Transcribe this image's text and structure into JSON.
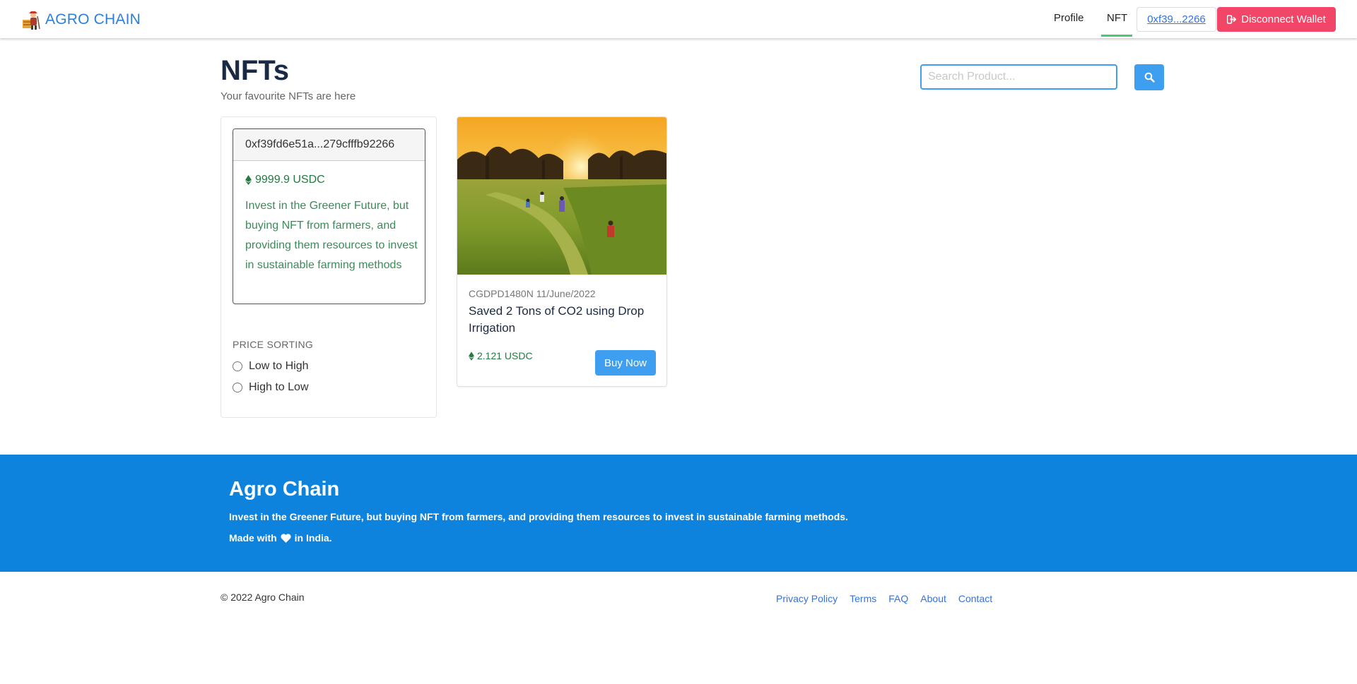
{
  "navbar": {
    "brand": "AGRO CHAIN",
    "links": [
      {
        "label": "Profile"
      },
      {
        "label": "NFT"
      }
    ],
    "wallet_short": "0xf39...2266",
    "disconnect_label": "Disconnect Wallet"
  },
  "header": {
    "title": "NFTs",
    "subtitle": "Your favourite NFTs are here",
    "search_placeholder": "Search Product..."
  },
  "sidebar": {
    "wallet_address": "0xf39fd6e51a...279cfffb92266",
    "balance": "9999.9 USDC",
    "description": "Invest in the Greener Future, but buying NFT from farmers, and providing them resources to invest in sustainable farming methods",
    "sorting_title": "PRICE SORTING",
    "sort_options": [
      "Low to High",
      "High to Low"
    ]
  },
  "products": [
    {
      "meta": "CGDPD1480N 11/June/2022",
      "title": "Saved 2 Tons of CO2 using Drop Irrigation",
      "price": "2.121 USDC",
      "buy_label": "Buy Now"
    }
  ],
  "footer": {
    "title": "Agro Chain",
    "description": "Invest in the Greener Future, but buying NFT from farmers, and providing them resources to invest in sustainable farming methods.",
    "made_prefix": "Made with",
    "made_suffix": "in India.",
    "copyright": "© 2022 Agro Chain",
    "links": [
      "Privacy Policy",
      "Terms",
      "FAQ",
      "About",
      "Contact"
    ]
  },
  "colors": {
    "brand": "#2e7fd9",
    "primary": "#3e9ff0",
    "danger": "#f14668",
    "success": "#257942",
    "footer_bg": "#0e83dd",
    "active_underline": "#48c774"
  },
  "icons": {
    "brand": "farmer-logo-icon",
    "disconnect": "sign-out-icon",
    "search": "search-icon",
    "currency": "ethereum-icon",
    "heart": "heart-icon"
  }
}
